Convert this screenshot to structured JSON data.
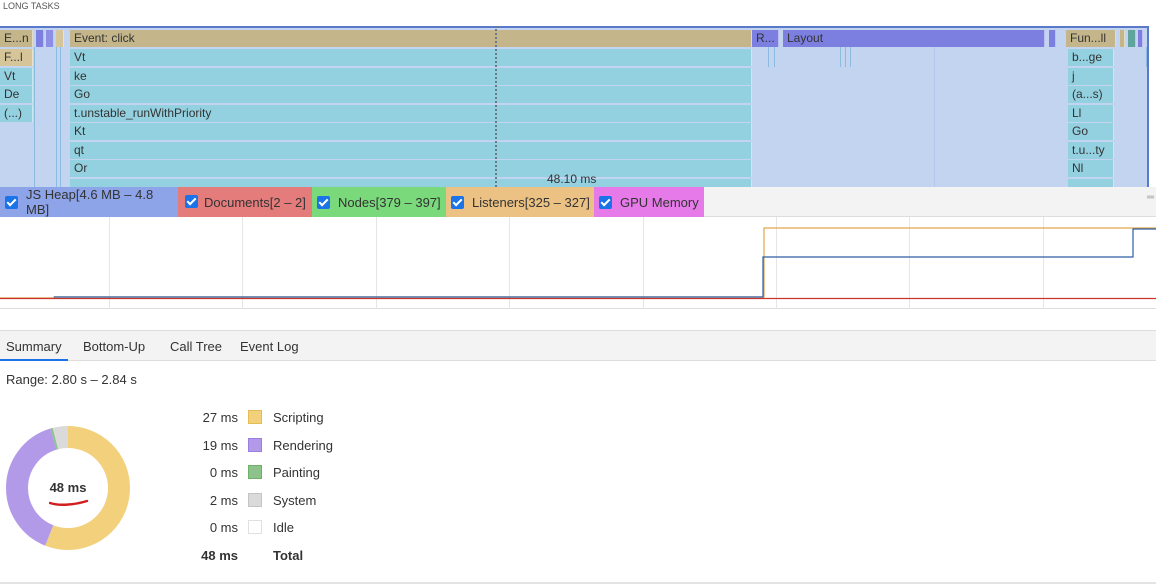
{
  "long_tasks_label": "LONG TASKS",
  "flame": {
    "col1": [
      "E...n",
      "F...l",
      "Vt",
      "De",
      "(...)"
    ],
    "main": [
      "Event: click",
      "Vt",
      "ke",
      "Go",
      "t.unstable_runWithPriority",
      "Kt",
      "qt",
      "Or"
    ],
    "r_label": "R...",
    "layout_label": "Layout",
    "right_col": [
      "Fun...ll",
      "b...ge",
      "j",
      "(a...s)",
      "Ll",
      "Go",
      "t.u...ty",
      "Nl"
    ],
    "range_label": "48.10 ms"
  },
  "counters": [
    {
      "label": "JS Heap[4.6 MB – 4.8 MB]",
      "color": "#8ea4e8",
      "checked": true
    },
    {
      "label": "Documents[2 – 2]",
      "color": "#e57c7c",
      "checked": true
    },
    {
      "label": "Nodes[379 – 397]",
      "color": "#7ad97a",
      "checked": true
    },
    {
      "label": "Listeners[325 – 327]",
      "color": "#ebc284",
      "checked": true
    },
    {
      "label": "GPU Memory",
      "color": "#e57ae8",
      "checked": true
    }
  ],
  "tabs": [
    "Summary",
    "Bottom-Up",
    "Call Tree",
    "Event Log"
  ],
  "active_tab": "Summary",
  "range_text": "Range: 2.80 s – 2.84 s",
  "donut_total": "48 ms",
  "summary": [
    {
      "value": "27 ms",
      "name": "Scripting",
      "color": "#f2d07c",
      "ms": 27
    },
    {
      "value": "19 ms",
      "name": "Rendering",
      "color": "#b39ae8",
      "ms": 19
    },
    {
      "value": "0 ms",
      "name": "Painting",
      "color": "#8dc28a",
      "ms": 0.3
    },
    {
      "value": "2 ms",
      "name": "System",
      "color": "#dadada",
      "ms": 2
    },
    {
      "value": "0 ms",
      "name": "Idle",
      "color": "#ffffff",
      "ms": 0
    }
  ],
  "total": {
    "value": "48 ms",
    "name": "Total"
  }
}
